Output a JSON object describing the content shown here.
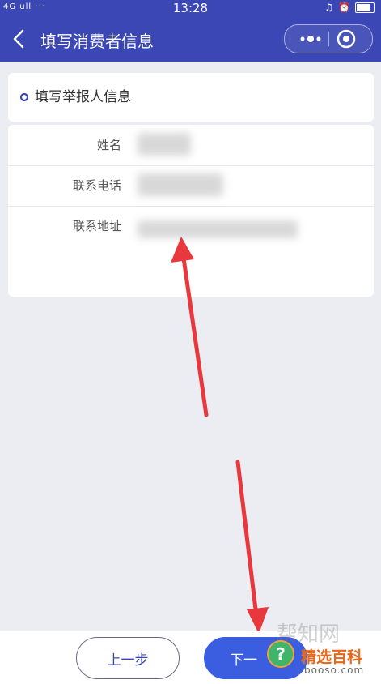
{
  "status_bar": {
    "signal": "4G ull ···",
    "time": "13:28"
  },
  "nav": {
    "title": "填写消费者信息"
  },
  "section": {
    "title": "填写举报人信息"
  },
  "form": {
    "fields": [
      {
        "label": "姓名"
      },
      {
        "label": "联系电话"
      },
      {
        "label": "联系地址"
      }
    ]
  },
  "buttons": {
    "prev": "上一步",
    "next": "下一"
  },
  "watermark": {
    "overlay": "帮知网",
    "name": "精选百科",
    "url": "booso.com"
  },
  "colors": {
    "brand": "#3b47b4",
    "next_button": "#3b5ee0",
    "arrow": "#e8373d"
  },
  "icons": [
    "back-icon",
    "more-icon",
    "target-icon",
    "ring-icon",
    "question-icon"
  ]
}
